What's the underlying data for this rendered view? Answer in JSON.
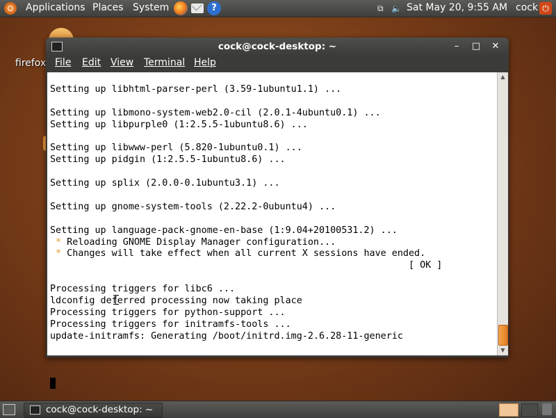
{
  "top_panel": {
    "applications": "Applications",
    "places": "Places",
    "system": "System",
    "datetime": "Sat May 20,  9:55 AM",
    "user": "cock",
    "help_glyph": "?",
    "power_glyph": "⏻",
    "volume_glyph": "🔈",
    "network_glyph": "⧉"
  },
  "desktop": {
    "firefox_label": "firefox"
  },
  "window": {
    "title": "cock@cock-desktop: ~",
    "min_glyph": "–",
    "max_glyph": "□",
    "close_glyph": "✕",
    "app_icon_glyph": "&gt;_",
    "menu": [
      "File",
      "Edit",
      "View",
      "Terminal",
      "Help"
    ]
  },
  "terminal": {
    "lines": [
      "Setting up libhtml-parser-perl (3.59-1ubuntu1.1) ...",
      "",
      "Setting up libmono-system-web2.0-cil (2.0.1-4ubuntu0.1) ...",
      "Setting up libpurple0 (1:2.5.5-1ubuntu8.6) ...",
      "",
      "Setting up libwww-perl (5.820-1ubuntu0.1) ...",
      "Setting up pidgin (1:2.5.5-1ubuntu8.6) ...",
      "",
      "Setting up splix (2.0.0-0.1ubuntu3.1) ...",
      "",
      "Setting up gnome-system-tools (2.22.2-0ubuntu4) ...",
      "",
      "Setting up language-pack-gnome-en-base (1:9.04+20100531.2) ...",
      " * Reloading GNOME Display Manager configuration...",
      " * Changes will take effect when all current X sessions have ended.",
      "                                                                [ OK ]",
      "",
      "Processing triggers for libc6 ...",
      "ldconfig deferred processing now taking place",
      "Processing triggers for python-support ...",
      "Processing triggers for initramfs-tools ...",
      "update-initramfs: Generating /boot/initrd.img-2.6.28-11-generic"
    ],
    "star_color": "#e69a2e"
  },
  "scrollbar": {
    "up_glyph": "▲",
    "down_glyph": "▼"
  },
  "bottom_panel": {
    "task_label": "cock@cock-desktop: ~"
  },
  "colors": {
    "accent_orange": "#e07c22",
    "panel_gray": "#4a4a47",
    "desktop_brown": "#7a3e18"
  }
}
